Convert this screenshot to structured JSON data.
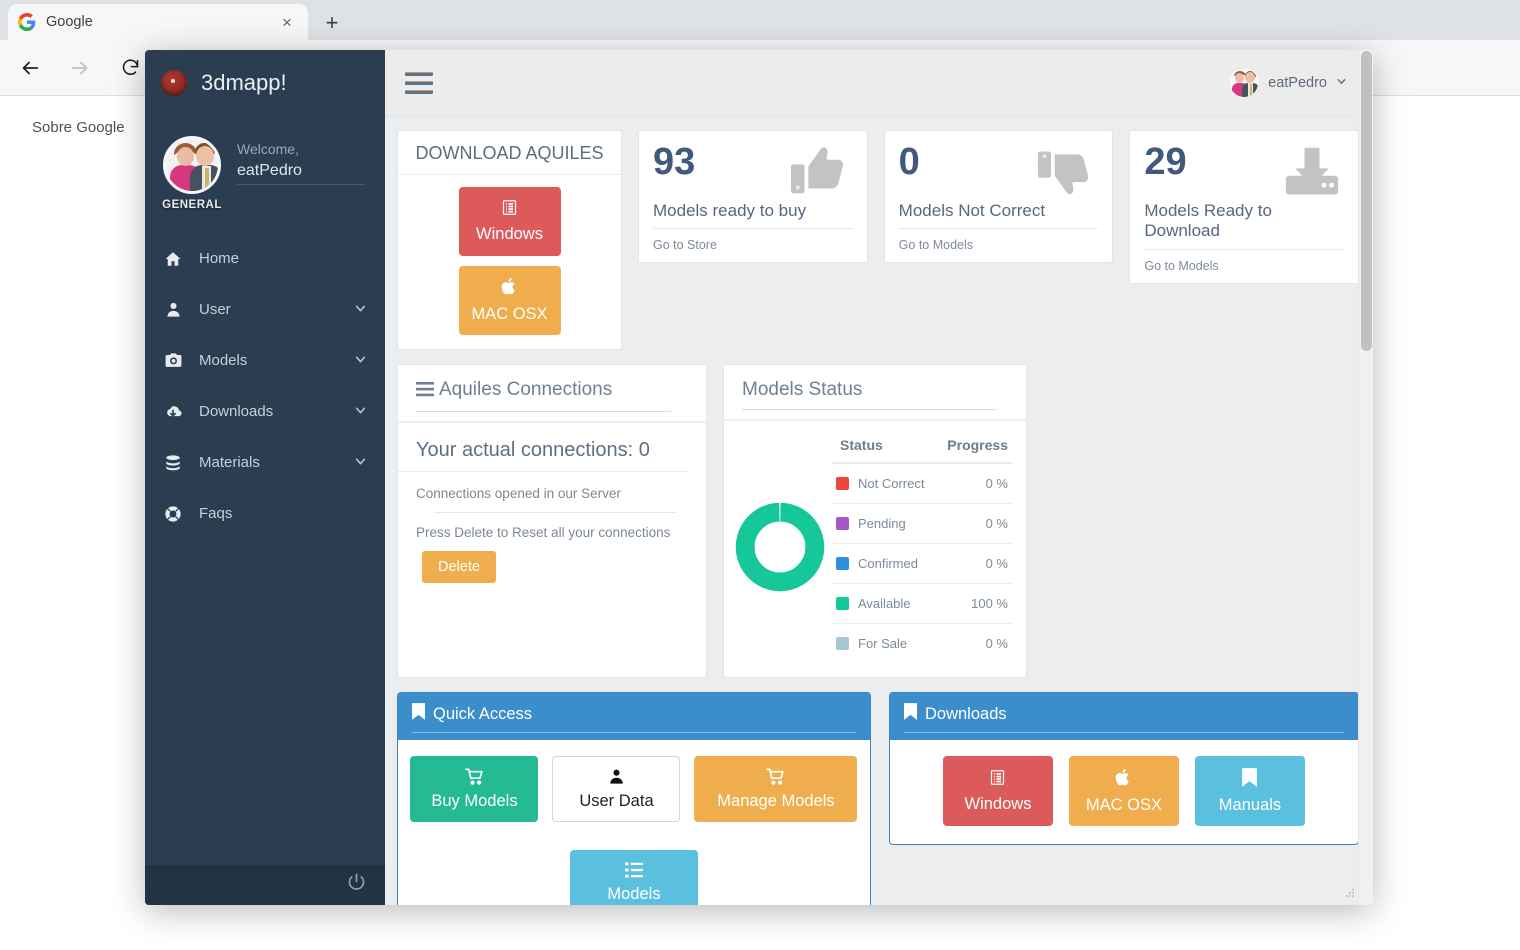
{
  "browser": {
    "tab_title": "Google",
    "tab_favicon": "google-icon",
    "close_label": "×",
    "newtab_label": "+",
    "back_icon": "back-arrow-icon",
    "forward_icon": "forward-arrow-icon",
    "reload_icon": "reload-icon",
    "page_link": "Sobre Google"
  },
  "sidebar": {
    "brand": "3dmapp!",
    "profile": {
      "general_label": "GENERAL",
      "welcome_label": "Welcome,",
      "username": "eatPedro"
    },
    "items": [
      {
        "label": "Home",
        "icon": "home-icon",
        "chevron": false
      },
      {
        "label": "User",
        "icon": "user-icon",
        "chevron": true
      },
      {
        "label": "Models",
        "icon": "camera-icon",
        "chevron": true
      },
      {
        "label": "Downloads",
        "icon": "cloud-download-icon",
        "chevron": true
      },
      {
        "label": "Materials",
        "icon": "database-icon",
        "chevron": true
      },
      {
        "label": "Faqs",
        "icon": "lifebuoy-icon",
        "chevron": false
      }
    ],
    "power_icon": "power-icon"
  },
  "topbar": {
    "menu_icon": "hamburger-icon",
    "username": "eatPedro",
    "caret_icon": "chevron-down-icon",
    "avatar": "user-avatar"
  },
  "download_card": {
    "title": "DOWNLOAD AQUILES",
    "buttons": [
      {
        "label": "Windows",
        "icon": "windows-list-icon",
        "color": "#dd5a5a"
      },
      {
        "label": "MAC OSX",
        "icon": "apple-icon",
        "color": "#efad4d"
      }
    ]
  },
  "stats": [
    {
      "value": "93",
      "label": "Models ready to buy",
      "link": "Go to Store",
      "icon": "thumbs-up-icon"
    },
    {
      "value": "0",
      "label": "Models Not Correct",
      "link": "Go to Models",
      "icon": "thumbs-down-icon"
    },
    {
      "value": "29",
      "label": "Models Ready to Download",
      "link": "Go to Models",
      "icon": "download-inbox-icon"
    }
  ],
  "connections": {
    "title": "Aquiles Connections",
    "title_icon": "list-lines-icon",
    "actual": "Your actual connections: 0",
    "subtitle": "Connections opened in our Server",
    "hint": "Press Delete to Reset all your connections",
    "delete_label": "Delete"
  },
  "models_status": {
    "title": "Models Status",
    "columns": [
      "Status",
      "Progress"
    ],
    "rows": [
      {
        "label": "Not Correct",
        "value": "0 %",
        "color": "#f0453a"
      },
      {
        "label": "Pending",
        "value": "0 %",
        "color": "#a855c8"
      },
      {
        "label": "Confirmed",
        "value": "0 %",
        "color": "#2e8fe0"
      },
      {
        "label": "Available",
        "value": "100 %",
        "color": "#16c79a"
      },
      {
        "label": "For Sale",
        "value": "0 %",
        "color": "#a7c8d0"
      }
    ]
  },
  "chart_data": {
    "type": "pie",
    "title": "Models Status",
    "categories": [
      "Not Correct",
      "Pending",
      "Confirmed",
      "Available",
      "For Sale"
    ],
    "values": [
      0,
      0,
      0,
      100,
      0
    ],
    "colors": [
      "#f0453a",
      "#a855c8",
      "#2e8fe0",
      "#16c79a",
      "#a7c8d0"
    ],
    "unit": "%",
    "donut": true,
    "legend": "right"
  },
  "quick_access": {
    "title": "Quick Access",
    "title_icon": "bookmark-icon",
    "buttons": [
      {
        "label": "Buy Models",
        "icon": "cart-icon",
        "color": "#23ba94",
        "wide": false
      },
      {
        "label": "User Data",
        "icon": "person-icon",
        "color": "#ffffff",
        "wide": false
      },
      {
        "label": "Manage Models",
        "icon": "cart-icon",
        "color": "#efad4d",
        "wide": true
      },
      {
        "label": "Models",
        "icon": "list-icon",
        "color": "#5bc0de",
        "wide": false
      }
    ]
  },
  "downloads_panel": {
    "title": "Downloads",
    "title_icon": "bookmark-icon",
    "buttons": [
      {
        "label": "Windows",
        "icon": "windows-list-icon",
        "color": "#dd5a5a"
      },
      {
        "label": "MAC OSX",
        "icon": "apple-icon",
        "color": "#efad4d"
      },
      {
        "label": "Manuals",
        "icon": "bookmark-icon",
        "color": "#5bc0de"
      }
    ]
  }
}
